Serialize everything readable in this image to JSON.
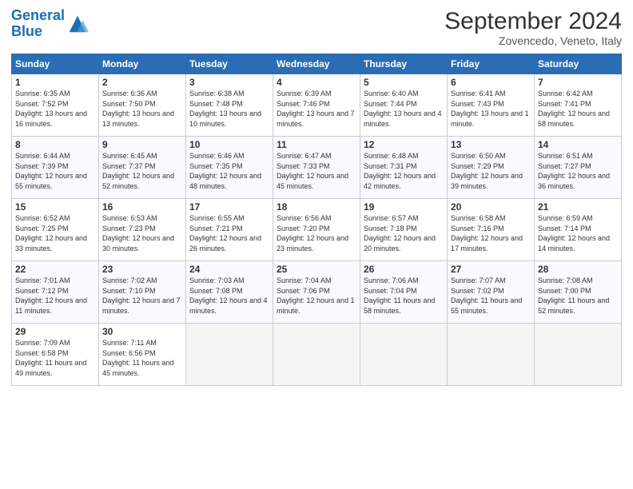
{
  "header": {
    "logo_line1": "General",
    "logo_line2": "Blue",
    "month_title": "September 2024",
    "location": "Zovencedo, Veneto, Italy"
  },
  "weekdays": [
    "Sunday",
    "Monday",
    "Tuesday",
    "Wednesday",
    "Thursday",
    "Friday",
    "Saturday"
  ],
  "weeks": [
    [
      {
        "day": "1",
        "sunrise": "Sunrise: 6:35 AM",
        "sunset": "Sunset: 7:52 PM",
        "daylight": "Daylight: 13 hours and 16 minutes."
      },
      {
        "day": "2",
        "sunrise": "Sunrise: 6:36 AM",
        "sunset": "Sunset: 7:50 PM",
        "daylight": "Daylight: 13 hours and 13 minutes."
      },
      {
        "day": "3",
        "sunrise": "Sunrise: 6:38 AM",
        "sunset": "Sunset: 7:48 PM",
        "daylight": "Daylight: 13 hours and 10 minutes."
      },
      {
        "day": "4",
        "sunrise": "Sunrise: 6:39 AM",
        "sunset": "Sunset: 7:46 PM",
        "daylight": "Daylight: 13 hours and 7 minutes."
      },
      {
        "day": "5",
        "sunrise": "Sunrise: 6:40 AM",
        "sunset": "Sunset: 7:44 PM",
        "daylight": "Daylight: 13 hours and 4 minutes."
      },
      {
        "day": "6",
        "sunrise": "Sunrise: 6:41 AM",
        "sunset": "Sunset: 7:43 PM",
        "daylight": "Daylight: 13 hours and 1 minute."
      },
      {
        "day": "7",
        "sunrise": "Sunrise: 6:42 AM",
        "sunset": "Sunset: 7:41 PM",
        "daylight": "Daylight: 12 hours and 58 minutes."
      }
    ],
    [
      {
        "day": "8",
        "sunrise": "Sunrise: 6:44 AM",
        "sunset": "Sunset: 7:39 PM",
        "daylight": "Daylight: 12 hours and 55 minutes."
      },
      {
        "day": "9",
        "sunrise": "Sunrise: 6:45 AM",
        "sunset": "Sunset: 7:37 PM",
        "daylight": "Daylight: 12 hours and 52 minutes."
      },
      {
        "day": "10",
        "sunrise": "Sunrise: 6:46 AM",
        "sunset": "Sunset: 7:35 PM",
        "daylight": "Daylight: 12 hours and 48 minutes."
      },
      {
        "day": "11",
        "sunrise": "Sunrise: 6:47 AM",
        "sunset": "Sunset: 7:33 PM",
        "daylight": "Daylight: 12 hours and 45 minutes."
      },
      {
        "day": "12",
        "sunrise": "Sunrise: 6:48 AM",
        "sunset": "Sunset: 7:31 PM",
        "daylight": "Daylight: 12 hours and 42 minutes."
      },
      {
        "day": "13",
        "sunrise": "Sunrise: 6:50 AM",
        "sunset": "Sunset: 7:29 PM",
        "daylight": "Daylight: 12 hours and 39 minutes."
      },
      {
        "day": "14",
        "sunrise": "Sunrise: 6:51 AM",
        "sunset": "Sunset: 7:27 PM",
        "daylight": "Daylight: 12 hours and 36 minutes."
      }
    ],
    [
      {
        "day": "15",
        "sunrise": "Sunrise: 6:52 AM",
        "sunset": "Sunset: 7:25 PM",
        "daylight": "Daylight: 12 hours and 33 minutes."
      },
      {
        "day": "16",
        "sunrise": "Sunrise: 6:53 AM",
        "sunset": "Sunset: 7:23 PM",
        "daylight": "Daylight: 12 hours and 30 minutes."
      },
      {
        "day": "17",
        "sunrise": "Sunrise: 6:55 AM",
        "sunset": "Sunset: 7:21 PM",
        "daylight": "Daylight: 12 hours and 26 minutes."
      },
      {
        "day": "18",
        "sunrise": "Sunrise: 6:56 AM",
        "sunset": "Sunset: 7:20 PM",
        "daylight": "Daylight: 12 hours and 23 minutes."
      },
      {
        "day": "19",
        "sunrise": "Sunrise: 6:57 AM",
        "sunset": "Sunset: 7:18 PM",
        "daylight": "Daylight: 12 hours and 20 minutes."
      },
      {
        "day": "20",
        "sunrise": "Sunrise: 6:58 AM",
        "sunset": "Sunset: 7:16 PM",
        "daylight": "Daylight: 12 hours and 17 minutes."
      },
      {
        "day": "21",
        "sunrise": "Sunrise: 6:59 AM",
        "sunset": "Sunset: 7:14 PM",
        "daylight": "Daylight: 12 hours and 14 minutes."
      }
    ],
    [
      {
        "day": "22",
        "sunrise": "Sunrise: 7:01 AM",
        "sunset": "Sunset: 7:12 PM",
        "daylight": "Daylight: 12 hours and 11 minutes."
      },
      {
        "day": "23",
        "sunrise": "Sunrise: 7:02 AM",
        "sunset": "Sunset: 7:10 PM",
        "daylight": "Daylight: 12 hours and 7 minutes."
      },
      {
        "day": "24",
        "sunrise": "Sunrise: 7:03 AM",
        "sunset": "Sunset: 7:08 PM",
        "daylight": "Daylight: 12 hours and 4 minutes."
      },
      {
        "day": "25",
        "sunrise": "Sunrise: 7:04 AM",
        "sunset": "Sunset: 7:06 PM",
        "daylight": "Daylight: 12 hours and 1 minute."
      },
      {
        "day": "26",
        "sunrise": "Sunrise: 7:06 AM",
        "sunset": "Sunset: 7:04 PM",
        "daylight": "Daylight: 11 hours and 58 minutes."
      },
      {
        "day": "27",
        "sunrise": "Sunrise: 7:07 AM",
        "sunset": "Sunset: 7:02 PM",
        "daylight": "Daylight: 11 hours and 55 minutes."
      },
      {
        "day": "28",
        "sunrise": "Sunrise: 7:08 AM",
        "sunset": "Sunset: 7:00 PM",
        "daylight": "Daylight: 11 hours and 52 minutes."
      }
    ],
    [
      {
        "day": "29",
        "sunrise": "Sunrise: 7:09 AM",
        "sunset": "Sunset: 6:58 PM",
        "daylight": "Daylight: 11 hours and 49 minutes."
      },
      {
        "day": "30",
        "sunrise": "Sunrise: 7:11 AM",
        "sunset": "Sunset: 6:56 PM",
        "daylight": "Daylight: 11 hours and 45 minutes."
      },
      null,
      null,
      null,
      null,
      null
    ]
  ]
}
